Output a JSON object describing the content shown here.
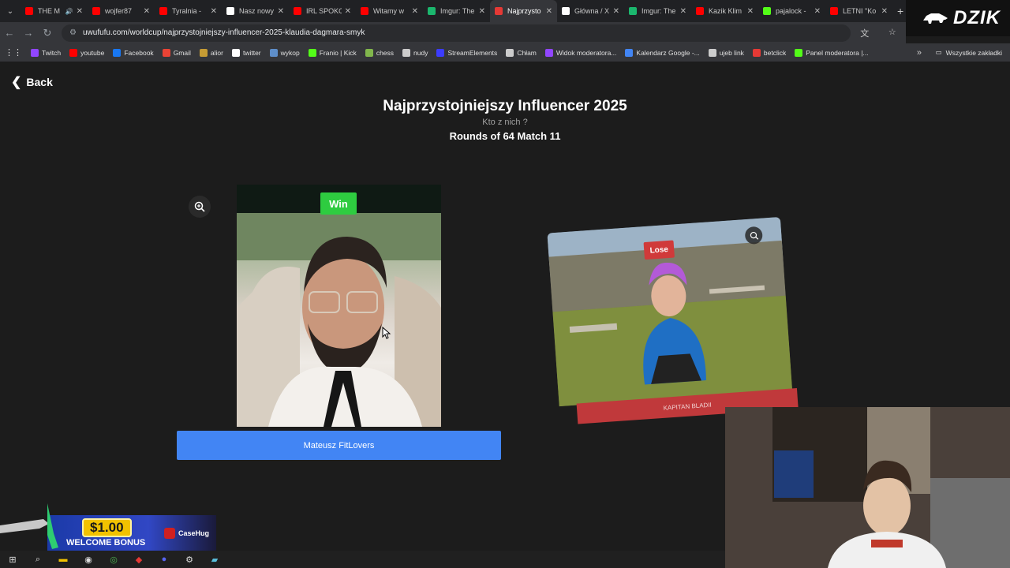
{
  "browser": {
    "tabs": [
      {
        "title": "THE M",
        "icon": "youtube-icon",
        "color": "#ff0000",
        "audio": true
      },
      {
        "title": "wojfer87",
        "icon": "youtube-icon",
        "color": "#ff0000"
      },
      {
        "title": "Tyralnia -",
        "icon": "youtube-icon",
        "color": "#ff0000"
      },
      {
        "title": "Nasz nowy",
        "icon": "google-icon",
        "color": "#ffffff"
      },
      {
        "title": "IRL SPOKO",
        "icon": "youtube-icon",
        "color": "#ff0000"
      },
      {
        "title": "Witamy w",
        "icon": "youtube-icon",
        "color": "#ff0000"
      },
      {
        "title": "Imgur: The",
        "icon": "imgur-icon",
        "color": "#1bb76e"
      },
      {
        "title": "Najprzysto",
        "icon": "uwufufu-icon",
        "color": "#e53935",
        "active": true
      },
      {
        "title": "Główna / X",
        "icon": "x-icon",
        "color": "#ffffff"
      },
      {
        "title": "Imgur: The",
        "icon": "imgur-icon",
        "color": "#1bb76e"
      },
      {
        "title": "Kazik Klim",
        "icon": "youtube-icon",
        "color": "#ff0000"
      },
      {
        "title": "pajalock -",
        "icon": "kick-icon",
        "color": "#53fc18"
      },
      {
        "title": "LETNI \"Ko",
        "icon": "youtube-icon",
        "color": "#ff0000"
      }
    ],
    "url": "uwufufu.com/worldcup/najprzystojniejszy-influencer-2025-klaudia-dagmara-smyk",
    "bookmarks": [
      {
        "label": "Twitch",
        "color": "#9146ff"
      },
      {
        "label": "youtube",
        "color": "#ff0000"
      },
      {
        "label": "Facebook",
        "color": "#1877f2"
      },
      {
        "label": "Gmail",
        "color": "#ea4335"
      },
      {
        "label": "alior",
        "color": "#c69c34"
      },
      {
        "label": "twitter",
        "color": "#ffffff"
      },
      {
        "label": "wykop",
        "color": "#5e8ec9"
      },
      {
        "label": "Franio | Kick",
        "color": "#53fc18"
      },
      {
        "label": "chess",
        "color": "#81b64c"
      },
      {
        "label": "nudy",
        "color": "#cccccc"
      },
      {
        "label": "StreamElements",
        "color": "#3c3cff"
      },
      {
        "label": "Chłam",
        "color": "#cccccc"
      },
      {
        "label": "Widok moderatora...",
        "color": "#9146ff"
      },
      {
        "label": "Kalendarz Google -...",
        "color": "#4285f4"
      },
      {
        "label": "ujeb link",
        "color": "#cccccc"
      },
      {
        "label": "betclick",
        "color": "#e53935"
      },
      {
        "label": "Panel moderatora |...",
        "color": "#53fc18"
      }
    ],
    "all_bookmarks": "Wszystkie zakładki"
  },
  "overlay": {
    "brand": "DZIK",
    "ad": {
      "price": "$1.00",
      "bonus": "WELCOME BONUS",
      "brand": "CaseHug"
    }
  },
  "page": {
    "back": "Back",
    "title": "Najprzystojniejszy Influencer 2025",
    "subtitle": "Kto z nich ?",
    "round": "Rounds of 64 Match 11",
    "left": {
      "badge": "Win",
      "name": "Mateusz FitLovers"
    },
    "right": {
      "badge": "Lose",
      "name": "KAPITAN BLADII"
    }
  }
}
